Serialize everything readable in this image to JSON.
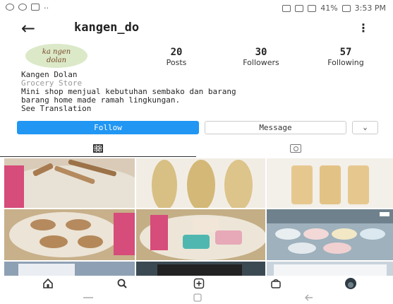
{
  "status_bar": {
    "battery": "41%",
    "time": "3:53 PM"
  },
  "header": {
    "username": "kangen_do",
    "back_icon": "back-arrow-icon",
    "more_icon": "more-vertical-icon"
  },
  "profile": {
    "avatar_text": "ka ngen dolan",
    "stats": [
      {
        "value": "20",
        "label": "Posts"
      },
      {
        "value": "30",
        "label": "Followers"
      },
      {
        "value": "57",
        "label": "Following"
      }
    ],
    "name": "Kangen Dolan",
    "category": "Grocery Store",
    "bio_line1": "Mini shop menjual kebutuhan sembako dan barang",
    "bio_line2": "barang home made ramah lingkungan.",
    "see_translation": "See Translation"
  },
  "actions": {
    "follow": "Follow",
    "message": "Message",
    "more": "⌄"
  },
  "tabs": [
    {
      "name": "grid",
      "icon": "grid-icon"
    },
    {
      "name": "tagged",
      "icon": "tagged-person-icon"
    }
  ],
  "posts": [
    {
      "desc": "bamboo toothbrushes"
    },
    {
      "desc": "loofah sponges"
    },
    {
      "desc": "soap bottles"
    },
    {
      "desc": "wooden dishes"
    },
    {
      "desc": "soap bars in basket"
    },
    {
      "desc": "soap bars display"
    },
    {
      "desc": "reusable bag"
    },
    {
      "desc": "dark items"
    },
    {
      "desc": "white items"
    }
  ],
  "bottom_nav": [
    "home-icon",
    "search-icon",
    "add-post-icon",
    "shop-icon",
    "profile-avatar"
  ],
  "system_nav": [
    "recents-icon",
    "home-button-icon",
    "back-icon"
  ],
  "colors": {
    "accent": "#2196f3"
  }
}
